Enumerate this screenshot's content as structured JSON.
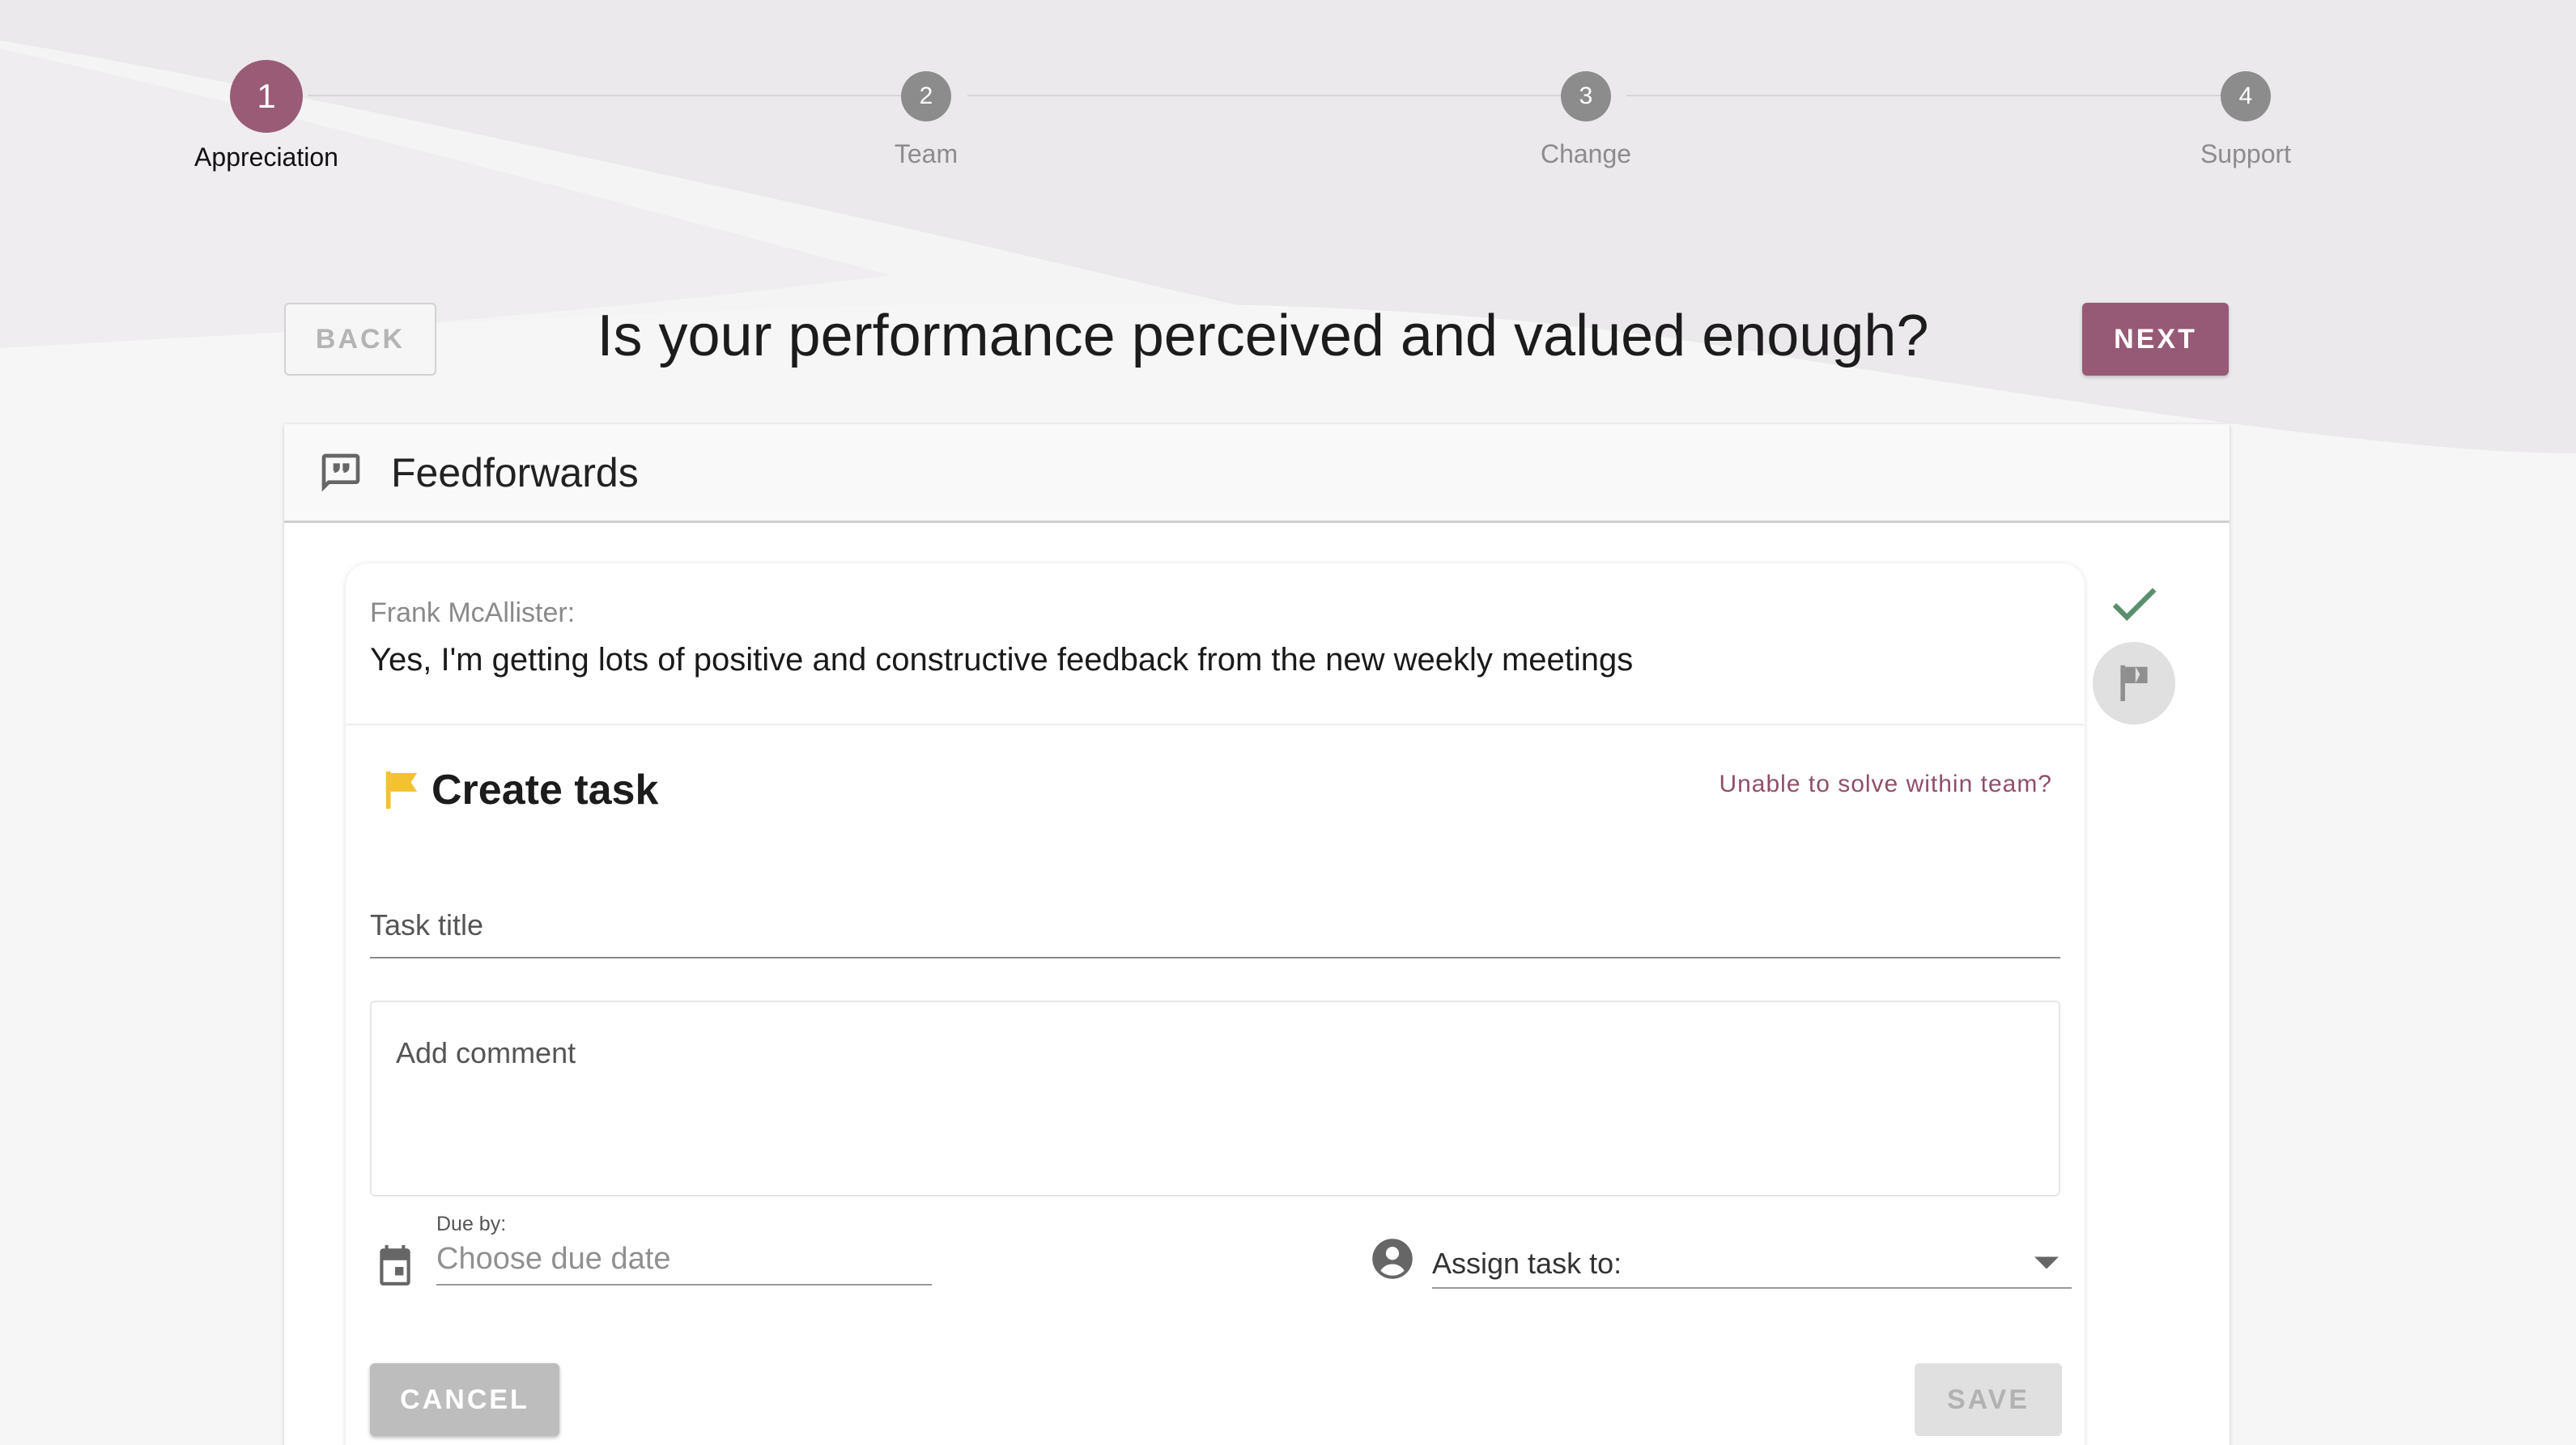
{
  "stepper": {
    "steps": [
      {
        "number": "1",
        "label": "Appreciation",
        "active": true
      },
      {
        "number": "2",
        "label": "Team",
        "active": false
      },
      {
        "number": "3",
        "label": "Change",
        "active": false
      },
      {
        "number": "4",
        "label": "Support",
        "active": false
      }
    ]
  },
  "header": {
    "back_label": "BACK",
    "question": "Is your performance perceived and valued enough?",
    "next_label": "NEXT"
  },
  "panel": {
    "icon": "feedback-quote-icon",
    "title": "Feedforwards"
  },
  "feedback": {
    "author": "Frank McAllister:",
    "text": "Yes, I'm getting lots of positive and constructive feedback from the new weekly meetings"
  },
  "task": {
    "title": "Create task",
    "unable_link": "Unable to solve within team?",
    "task_title_placeholder": "Task title",
    "comment_placeholder": "Add comment",
    "due_label": "Due by:",
    "due_placeholder": "Choose due date",
    "assign_label": "Assign task to:",
    "cancel_label": "CANCEL",
    "save_label": "SAVE"
  },
  "colors": {
    "accent": "#965a76",
    "flag_yellow": "#f2c230",
    "check_green": "#5a8f6e"
  }
}
